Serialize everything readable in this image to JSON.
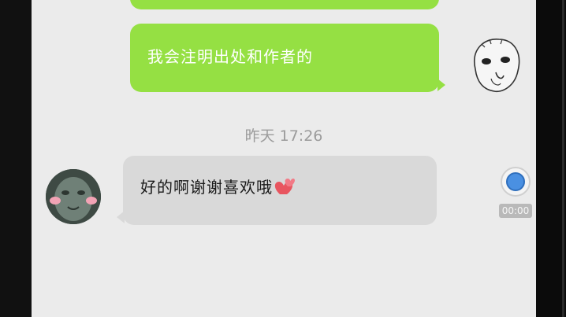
{
  "chat": {
    "messages": [
      {
        "sender": "me",
        "text": "我会注明出处和作者的"
      },
      {
        "sender": "friend",
        "text": "好的啊谢谢喜欢哦"
      }
    ],
    "timestamp": "昨天 17:26",
    "colors": {
      "outgoing_bubble": "#95e043",
      "incoming_bubble": "#d9d9d9",
      "background": "#ebebeb"
    }
  },
  "icons": {
    "me_avatar": "cartoon-sticker-avatar",
    "friend_avatar": "green-mask-avatar",
    "emoji": "two-hearts-emoji"
  },
  "recorder": {
    "time": "00:00",
    "accent": "#4a90e2"
  }
}
